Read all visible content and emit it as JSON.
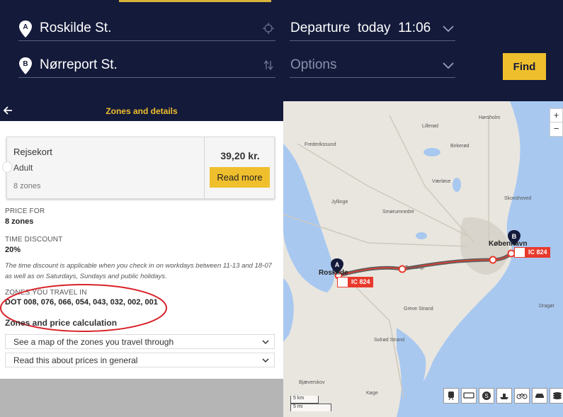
{
  "search": {
    "from": "Roskilde St.",
    "to": "Nørreport St.",
    "departure": "Departure  today  11:06",
    "options_placeholder": "Options",
    "find_label": "Find",
    "from_marker": "A",
    "to_marker": "B"
  },
  "zones_panel": {
    "title": "Zones and details",
    "ticket": {
      "name": "Rejsekort",
      "category": "Adult",
      "zones": "8 zones",
      "price": "39,20 kr.",
      "read_more": "Read more"
    },
    "price_for_label": "PRICE FOR",
    "price_for_value": "8 zones",
    "time_discount_label": "TIME DISCOUNT",
    "time_discount_value": "20%",
    "discount_note": "The time discount is applicable when you check in on workdays between 11-13 and 18-07 as well as on Saturdays, Sundays and public holidays.",
    "zones_label": "ZONES YOU TRAVEL IN",
    "zones_value": "DOT 008, 076, 066, 054, 043, 032, 002, 001",
    "calc_title": "Zones and price calculation",
    "dropdown_map": "See a map of the zones you travel through",
    "dropdown_prices": "Read this about prices in general"
  },
  "map": {
    "zoom_in": "+",
    "zoom_out": "−",
    "train_label_a": "IC 824",
    "train_label_b": "IC 824",
    "marker_a": "A",
    "marker_b": "B",
    "city_a": "Roskilde",
    "city_b": "København",
    "towns": [
      "Hørsholm",
      "Lillerød",
      "Frederikssund",
      "Birkerød",
      "Værløse",
      "Skovshoved",
      "Jyllinge",
      "Smørumnedre",
      "Taastrup",
      "Greve Strand",
      "Solrød Strand",
      "Køge",
      "Bjæverskov",
      "Dragør"
    ],
    "scale_km": "5 km",
    "scale_mi": "5 mi",
    "modes": [
      "train-icon",
      "bus-icon",
      "metro-icon",
      "ferry-icon",
      "bicycle-icon",
      "car-icon",
      "layers-icon"
    ],
    "accent_route": "#e8392c"
  },
  "colors": {
    "header_bg": "#141a3a",
    "accent": "#f0bf2d"
  }
}
